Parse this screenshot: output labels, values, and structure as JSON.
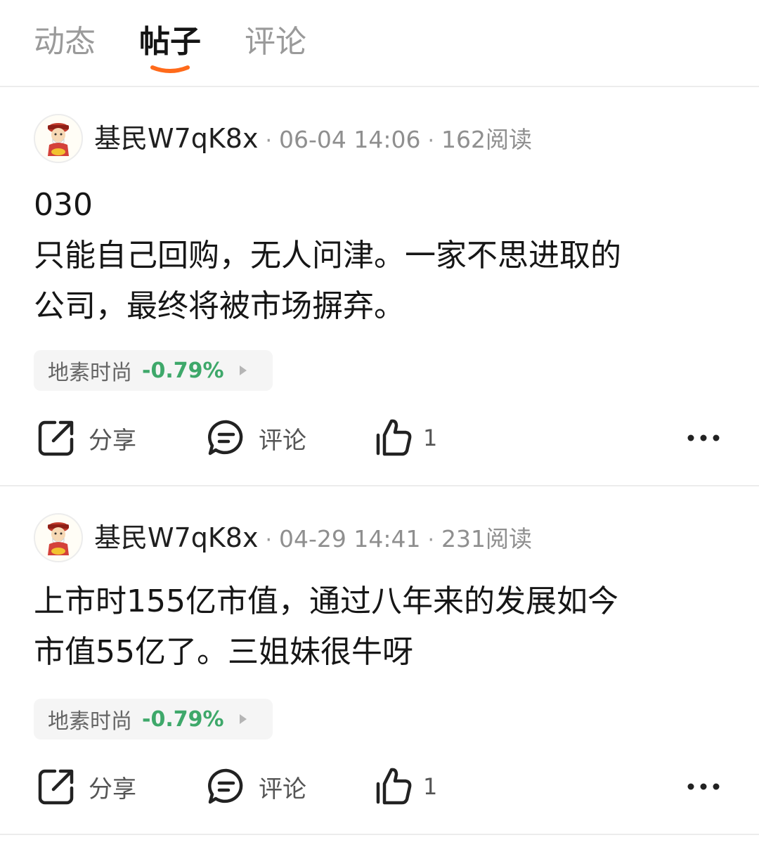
{
  "tabs": [
    {
      "label": "动态",
      "active": false
    },
    {
      "label": "帖子",
      "active": true
    },
    {
      "label": "评论",
      "active": false
    }
  ],
  "accent_color": "#ff6a1a",
  "stock_down_color": "#3ea86a",
  "posts": [
    {
      "username": "基民W7qK8x",
      "timestamp": "06-04 14:06",
      "reads": "162阅读",
      "content": [
        "030",
        "只能自己回购，无人问津。一家不思进取的",
        "公司，最终将被市场摒弃。"
      ],
      "stock": {
        "name": "地素时尚",
        "change": "-0.79%"
      },
      "actions": {
        "share_label": "分享",
        "comment_label": "评论",
        "like_count": "1"
      }
    },
    {
      "username": "基民W7qK8x",
      "timestamp": "04-29 14:41",
      "reads": "231阅读",
      "content": [
        "上市时155亿市值，通过八年来的发展如今",
        "市值55亿了。三姐妹很牛呀"
      ],
      "stock": {
        "name": "地素时尚",
        "change": "-0.79%"
      },
      "actions": {
        "share_label": "分享",
        "comment_label": "评论",
        "like_count": "1"
      }
    }
  ],
  "icons": {
    "avatar": "cartoon-fortune-god-avatar",
    "share": "share-icon",
    "comment": "comment-bubble-icon",
    "like": "thumbs-up-icon",
    "more": "more-dots-icon",
    "stock_arrow": "triangle-right-icon"
  }
}
